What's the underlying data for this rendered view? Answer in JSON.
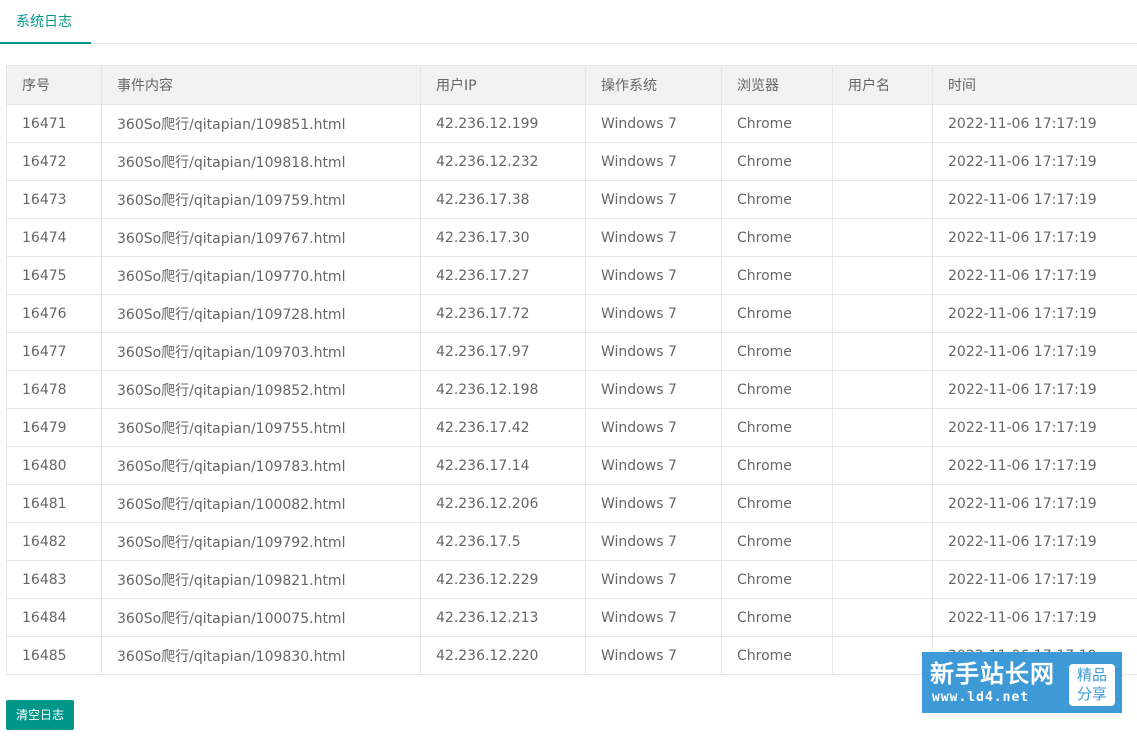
{
  "tabs": [
    {
      "label": "系统日志",
      "active": true
    }
  ],
  "table": {
    "columns": [
      "序号",
      "事件内容",
      "用户IP",
      "操作系统",
      "浏览器",
      "用户名",
      "时间"
    ],
    "rows": [
      [
        "16471",
        "360So爬行/qitapian/109851.html",
        "42.236.12.199",
        "Windows 7",
        "Chrome",
        "",
        "2022-11-06 17:17:19"
      ],
      [
        "16472",
        "360So爬行/qitapian/109818.html",
        "42.236.12.232",
        "Windows 7",
        "Chrome",
        "",
        "2022-11-06 17:17:19"
      ],
      [
        "16473",
        "360So爬行/qitapian/109759.html",
        "42.236.17.38",
        "Windows 7",
        "Chrome",
        "",
        "2022-11-06 17:17:19"
      ],
      [
        "16474",
        "360So爬行/qitapian/109767.html",
        "42.236.17.30",
        "Windows 7",
        "Chrome",
        "",
        "2022-11-06 17:17:19"
      ],
      [
        "16475",
        "360So爬行/qitapian/109770.html",
        "42.236.17.27",
        "Windows 7",
        "Chrome",
        "",
        "2022-11-06 17:17:19"
      ],
      [
        "16476",
        "360So爬行/qitapian/109728.html",
        "42.236.17.72",
        "Windows 7",
        "Chrome",
        "",
        "2022-11-06 17:17:19"
      ],
      [
        "16477",
        "360So爬行/qitapian/109703.html",
        "42.236.17.97",
        "Windows 7",
        "Chrome",
        "",
        "2022-11-06 17:17:19"
      ],
      [
        "16478",
        "360So爬行/qitapian/109852.html",
        "42.236.12.198",
        "Windows 7",
        "Chrome",
        "",
        "2022-11-06 17:17:19"
      ],
      [
        "16479",
        "360So爬行/qitapian/109755.html",
        "42.236.17.42",
        "Windows 7",
        "Chrome",
        "",
        "2022-11-06 17:17:19"
      ],
      [
        "16480",
        "360So爬行/qitapian/109783.html",
        "42.236.17.14",
        "Windows 7",
        "Chrome",
        "",
        "2022-11-06 17:17:19"
      ],
      [
        "16481",
        "360So爬行/qitapian/100082.html",
        "42.236.12.206",
        "Windows 7",
        "Chrome",
        "",
        "2022-11-06 17:17:19"
      ],
      [
        "16482",
        "360So爬行/qitapian/109792.html",
        "42.236.17.5",
        "Windows 7",
        "Chrome",
        "",
        "2022-11-06 17:17:19"
      ],
      [
        "16483",
        "360So爬行/qitapian/109821.html",
        "42.236.12.229",
        "Windows 7",
        "Chrome",
        "",
        "2022-11-06 17:17:19"
      ],
      [
        "16484",
        "360So爬行/qitapian/100075.html",
        "42.236.12.213",
        "Windows 7",
        "Chrome",
        "",
        "2022-11-06 17:17:19"
      ],
      [
        "16485",
        "360So爬行/qitapian/109830.html",
        "42.236.12.220",
        "Windows 7",
        "Chrome",
        "",
        "2022-11-06 17:17:19"
      ]
    ]
  },
  "actions": {
    "clear_label": "清空日志"
  },
  "watermark": {
    "title": "新手站长网",
    "url": "www.ld4.net",
    "badge_line1": "精品",
    "badge_line2": "分享"
  },
  "colors": {
    "accent": "#009688",
    "header_bg": "#f2f2f2",
    "border": "#e6e6e6",
    "watermark_bg": "#3d9ad6"
  }
}
